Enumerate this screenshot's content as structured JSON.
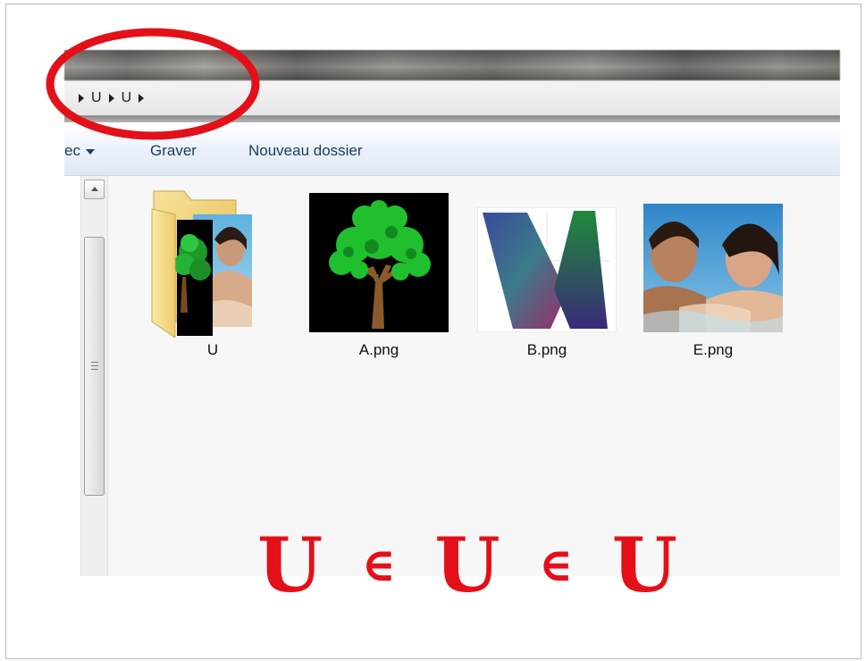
{
  "window": {
    "breadcrumb": [
      "U",
      "U"
    ]
  },
  "toolbar": {
    "share_partial_label": "ec",
    "burn_label": "Graver",
    "new_folder_label": "Nouveau dossier"
  },
  "files": [
    {
      "name": "U",
      "icon": "folder-icon"
    },
    {
      "name": "A.png",
      "icon": "tree-image"
    },
    {
      "name": "B.png",
      "icon": "gradient-image"
    },
    {
      "name": "E.png",
      "icon": "photo-image"
    }
  ],
  "equation": {
    "u1": "U",
    "op1": "∈",
    "u2": "U",
    "op2": "∈",
    "u3": "U"
  },
  "colors": {
    "annotation_red": "#e31019",
    "toolbar_text": "#1e3a5f"
  }
}
